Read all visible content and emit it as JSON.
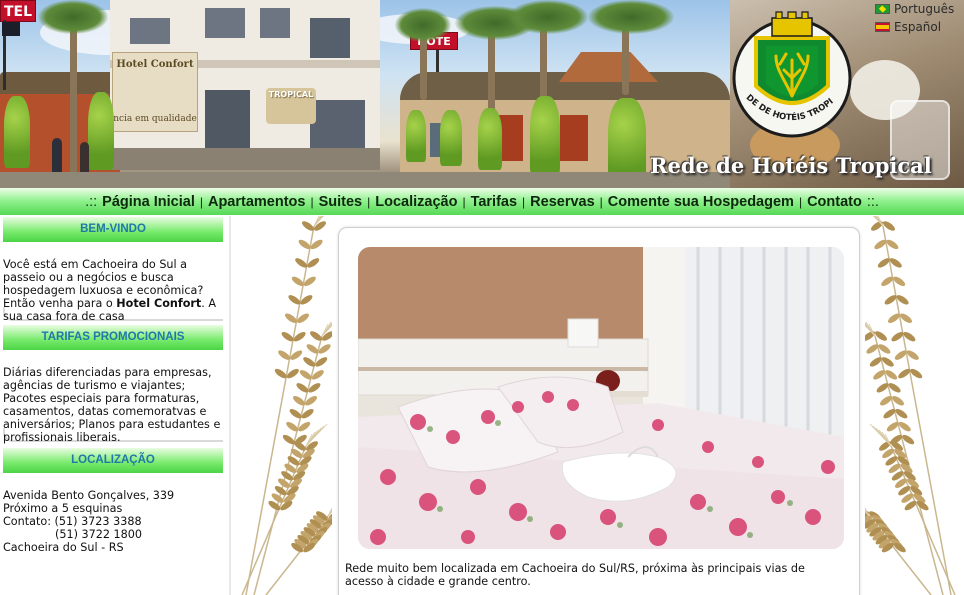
{
  "banner": {
    "title": "Rede de Hotéis Tropical",
    "crest_text": "REDE DE HOTÉIS TROPICAL",
    "languages": [
      {
        "label": "Português",
        "flag": "brazil-flag-icon"
      },
      {
        "label": "Español",
        "flag": "spain-flag-icon"
      }
    ],
    "signs": {
      "left_sign": "TEL",
      "center_sign": "HOTE",
      "building_sign": "Hotel Confort",
      "building_tagline": "ncia em qualidade",
      "tropical_sign": "TROPICAL"
    }
  },
  "nav": {
    "prefix": ".::",
    "suffix": "::.",
    "items": [
      {
        "label": "Página Inicial"
      },
      {
        "label": "Apartamentos"
      },
      {
        "label": "Suites"
      },
      {
        "label": "Localização"
      },
      {
        "label": "Tarifas"
      },
      {
        "label": "Reservas"
      },
      {
        "label": "Comente sua Hospedagem"
      },
      {
        "label": "Contato"
      }
    ]
  },
  "sidebar": {
    "welcome": {
      "heading": "BEM-VINDO",
      "text_before": "Você está em Cachoeira do Sul a passeio ou a negócios e busca hospedagem luxuosa e econômica? Então venha para o ",
      "hotel_name": "Hotel Confort",
      "text_after": ". A sua casa fora de casa"
    },
    "promo": {
      "heading": "TARIFAS PROMOCIONAIS",
      "text": "Diárias diferenciadas para empresas, agências de turismo e viajantes; Pacotes especiais para formaturas, casamentos, datas comemoratvas e aniversários; Planos para estudantes e profissionais liberais."
    },
    "location": {
      "heading": "LOCALIZAÇÃO",
      "lines": [
        "Avenida Bento Gonçalves, 339",
        "Próximo a 5 esquinas",
        "Contato: (51) 3723 3388",
        "(51) 3722 1800",
        "Cachoeira do Sul - RS"
      ]
    }
  },
  "content": {
    "intro": "Rede muito bem localizada em Cachoeira do Sul/RS, próxima às principais vias de acesso à cidade e grande centro."
  },
  "colors": {
    "nav_green": "#56d856",
    "heading_blue": "#1f79a8",
    "sidebar_green": "#4cd447"
  }
}
